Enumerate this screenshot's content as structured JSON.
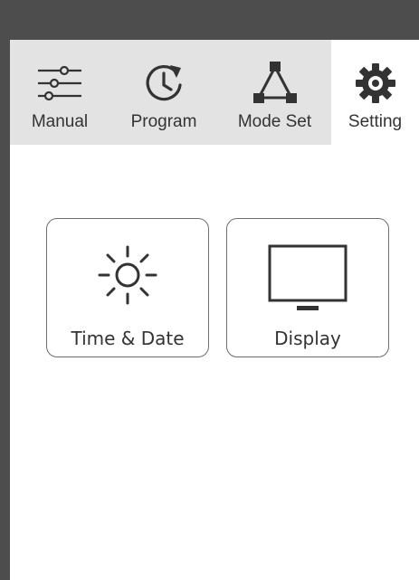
{
  "tabs": [
    {
      "label": "Manual",
      "icon": "sliders-icon",
      "active": false
    },
    {
      "label": "Program",
      "icon": "clock-refresh-icon",
      "active": false
    },
    {
      "label": "Mode Set",
      "icon": "triangle-network-icon",
      "active": false
    },
    {
      "label": "Setting",
      "icon": "gear-icon",
      "active": true
    }
  ],
  "tiles": [
    {
      "label": "Time & Date",
      "icon": "sun-icon"
    },
    {
      "label": "Display",
      "icon": "monitor-icon"
    }
  ],
  "colors": {
    "top_bar": "#4d4d4d",
    "inactive_tab": "#e3e3e3",
    "active_tab": "#ffffff",
    "icon": "#333333"
  }
}
